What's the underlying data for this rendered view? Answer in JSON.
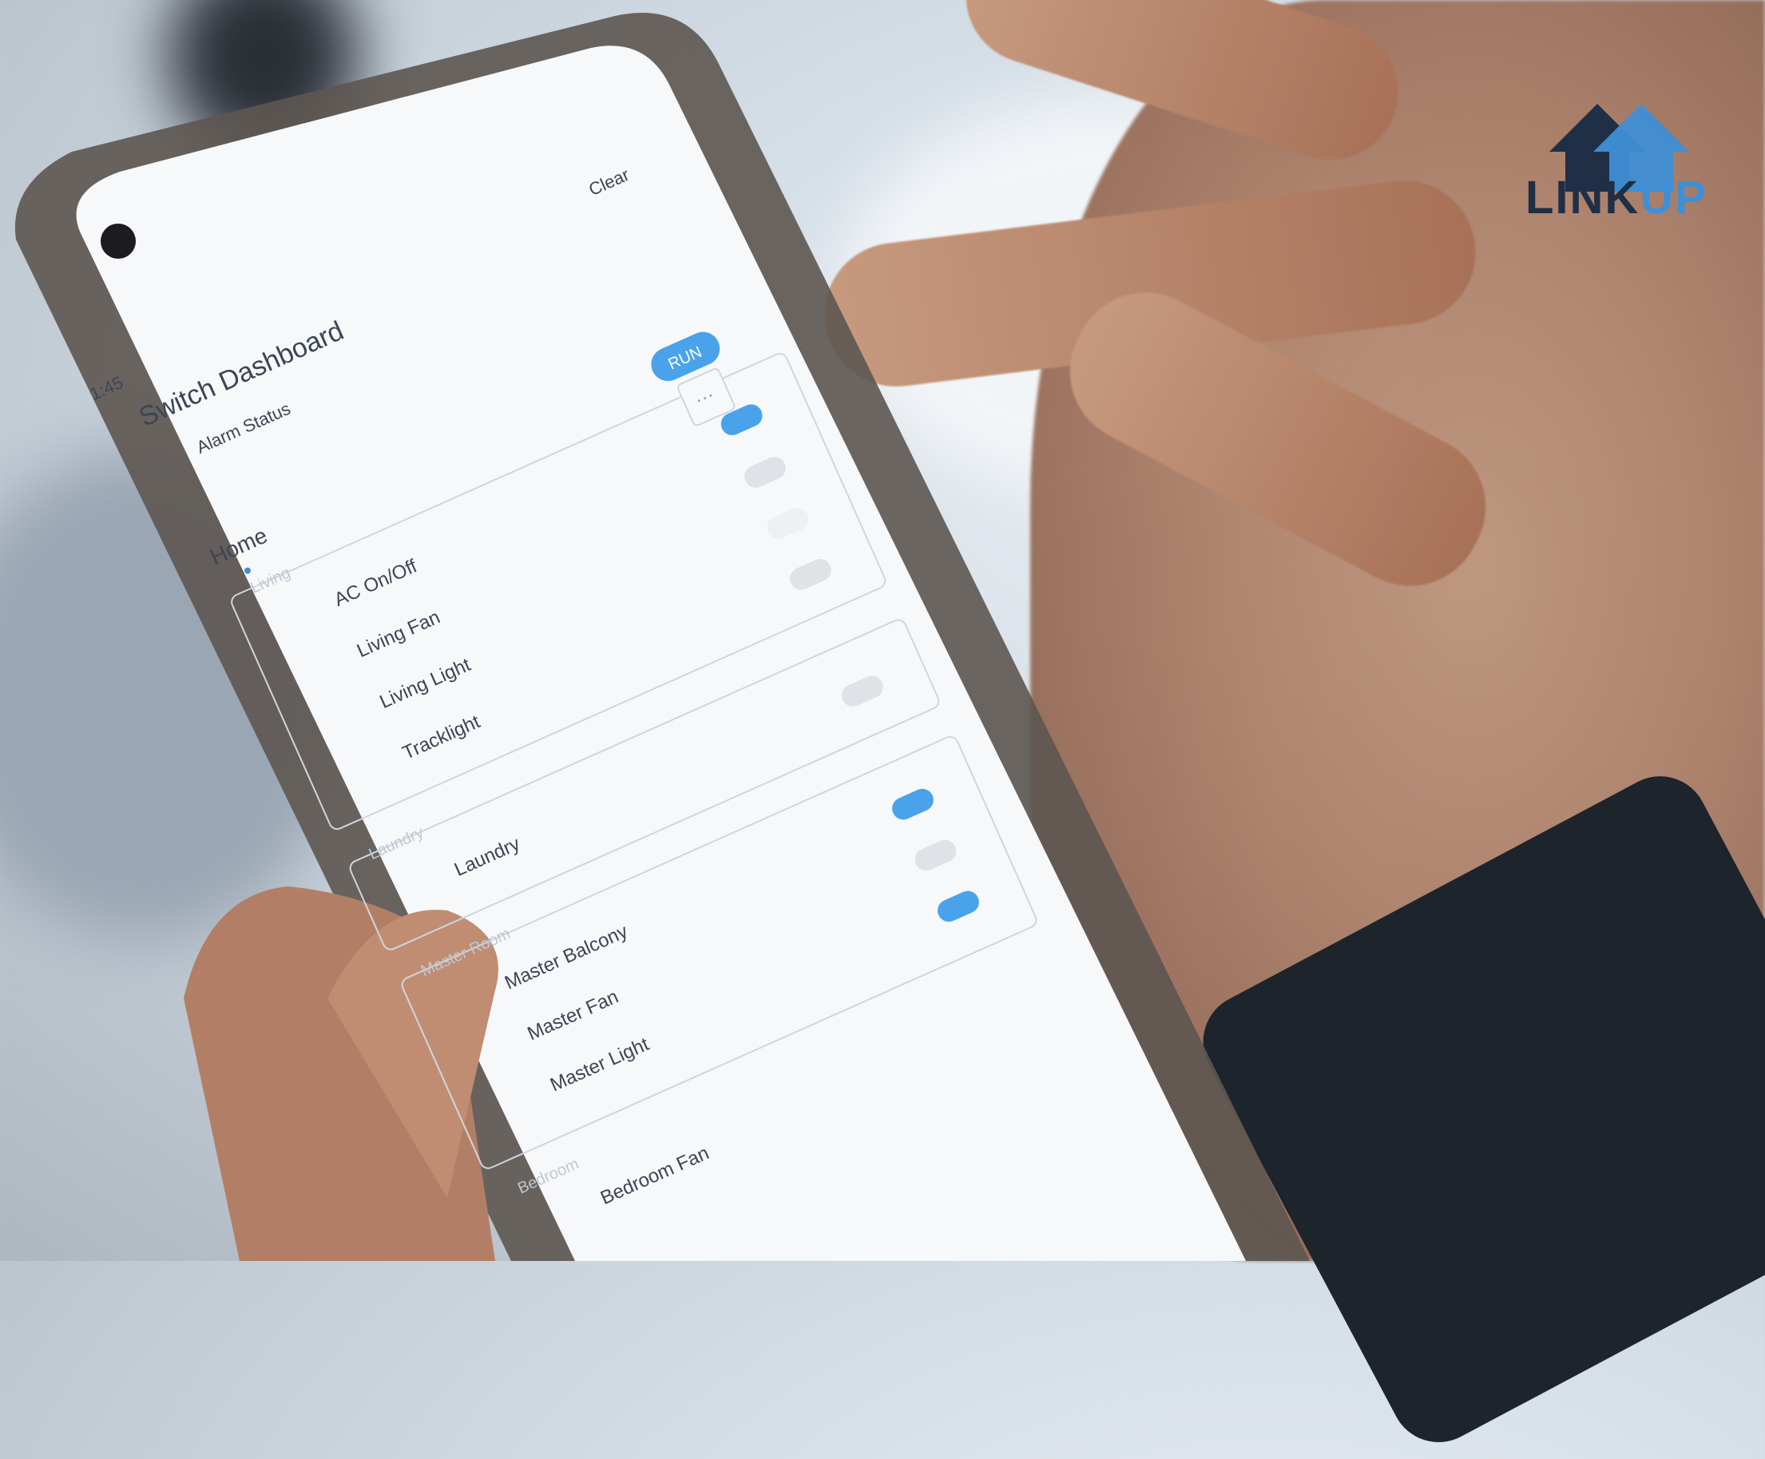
{
  "brand": {
    "logo_text_1": "LINK",
    "logo_text_2": "UP",
    "colors": {
      "dark": "#1f2f46",
      "accent": "#3f8fd6"
    }
  },
  "status_bar": {
    "time": "1:45"
  },
  "header": {
    "title": "Switch Dashboard",
    "subtitle": "Alarm Status",
    "clear_label": "Clear"
  },
  "tab": {
    "label": "Home"
  },
  "run_button": "RUN",
  "more_label": "···",
  "rooms": [
    {
      "name": "Living",
      "devices": [
        {
          "label": "AC On/Off",
          "on": true
        },
        {
          "label": "Living Fan",
          "on": false
        },
        {
          "label": "Living Light",
          "on": false
        },
        {
          "label": "Tracklight",
          "on": false
        }
      ]
    },
    {
      "name": "Laundry",
      "devices": [
        {
          "label": "Laundry",
          "on": false
        }
      ]
    },
    {
      "name": "Master Room",
      "devices": [
        {
          "label": "Master Balcony",
          "on": true
        },
        {
          "label": "Master Fan",
          "on": false
        },
        {
          "label": "Master Light",
          "on": true
        }
      ]
    },
    {
      "name": "Bedroom",
      "devices": [
        {
          "label": "Bedroom Fan",
          "on": false
        }
      ]
    }
  ]
}
